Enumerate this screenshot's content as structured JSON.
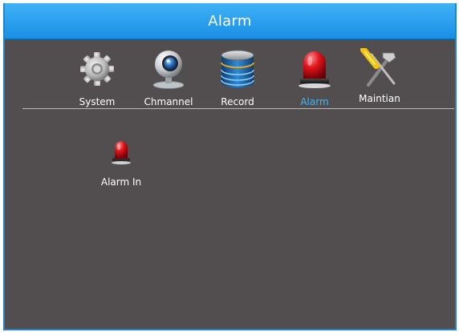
{
  "window": {
    "title": "Alarm"
  },
  "menu": {
    "tabs": [
      {
        "label": "System",
        "icon": "gear-icon"
      },
      {
        "label": "Chmannel",
        "icon": "camera-icon"
      },
      {
        "label": "Record",
        "icon": "hard-drive-icon"
      },
      {
        "label": "Alarm",
        "icon": "alarm-siren-icon",
        "active": true
      },
      {
        "label": "Maintian",
        "icon": "tools-icon"
      }
    ]
  },
  "content": {
    "items": [
      {
        "label": "Alarm In",
        "icon": "alarm-siren-icon"
      }
    ]
  },
  "colors": {
    "titlebar": "#1a8fe6",
    "background": "#524e4f",
    "active_tab": "#3fb6f5",
    "text": "#ffffff"
  }
}
